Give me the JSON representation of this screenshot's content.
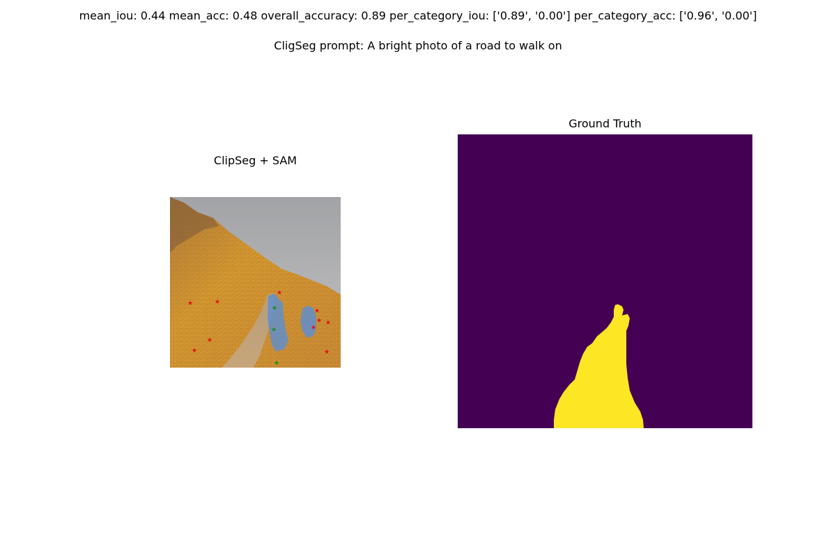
{
  "header": {
    "metrics": "mean_iou: 0.44  mean_acc: 0.48  overall_accuracy: 0.89  per_category_iou: ['0.89', '0.00']  per_category_acc: ['0.96', '0.00']",
    "prompt": "CligSeg prompt: A bright photo of a road to walk on"
  },
  "panels": {
    "prediction": {
      "title": "ClipSeg + SAM",
      "image": "hillside-path-photo",
      "overlay_color": "#5b8fd6",
      "positive_point_color": "#1a8c1a",
      "negative_point_color": "#e01010"
    },
    "ground_truth": {
      "title": "Ground Truth",
      "background_color": "#440154",
      "foreground_color": "#fde725"
    }
  }
}
